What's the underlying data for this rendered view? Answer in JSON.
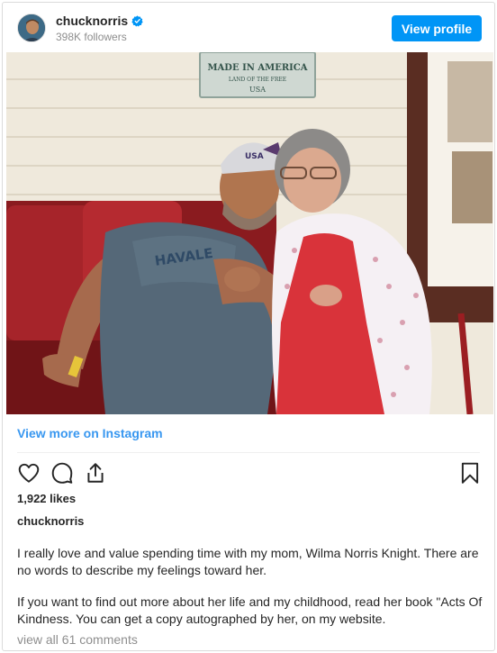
{
  "header": {
    "username": "chucknorris",
    "verified_icon": "verified-badge-icon",
    "followers": "398K followers",
    "view_profile_label": "View profile"
  },
  "photo": {
    "sign_line1": "MADE IN AMERICA",
    "sign_line2": "LAND OF THE FREE",
    "sign_line3": "USA",
    "shirt_text": "HAVALE",
    "cap_text": "USA"
  },
  "post": {
    "view_more_label": "View more on Instagram",
    "icons": [
      "heart-icon",
      "comment-icon",
      "share-icon",
      "bookmark-icon"
    ],
    "likes": "1,922 likes",
    "caption_user": "chucknorris",
    "caption_1": "I really love and value spending time with my mom, Wilma Norris Knight. There are no words to describe my feelings toward her.",
    "caption_2": "If you want to find out more about her life and my childhood, read her book \"Acts Of Kindness. You can get a copy autographed by her, on my website.",
    "view_comments_label": "view all 61 comments"
  },
  "colors": {
    "accent": "#0095f6",
    "link": "#3897f0",
    "muted": "#8e8e8e"
  }
}
